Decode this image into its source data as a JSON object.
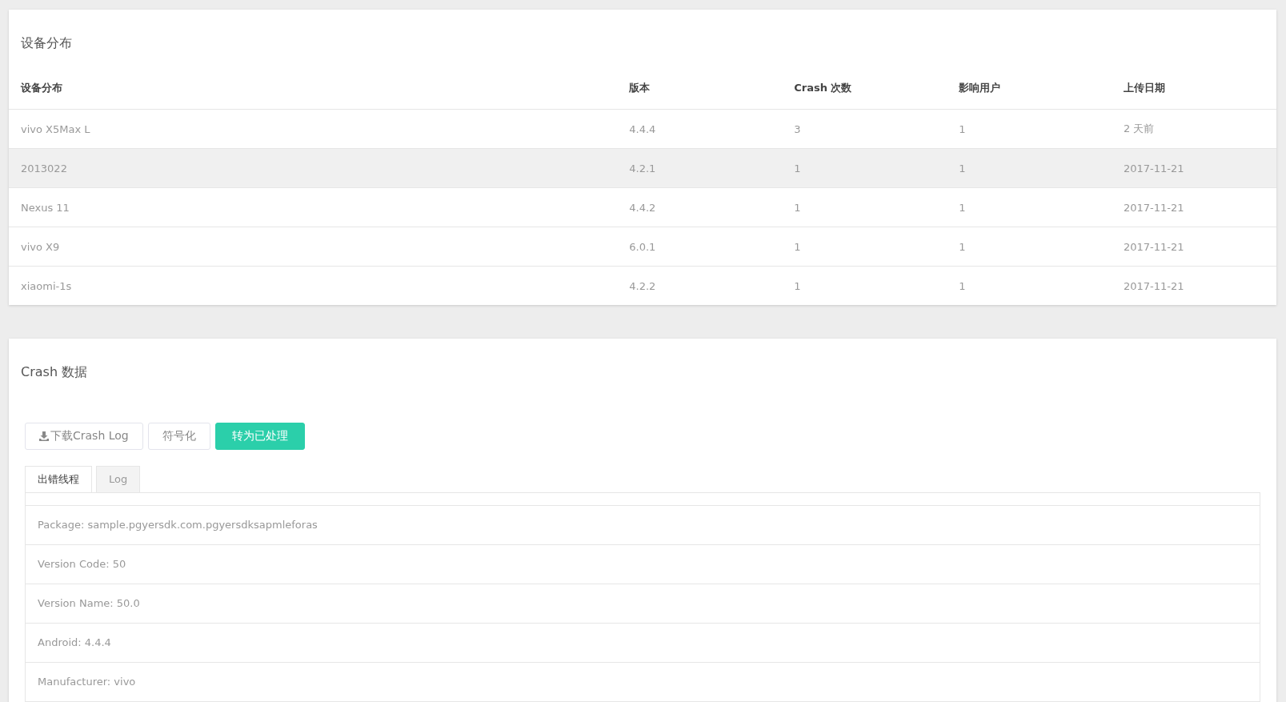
{
  "device_panel": {
    "title": "设备分布",
    "columns": [
      "设备分布",
      "版本",
      "Crash 次数",
      "影响用户",
      "上传日期"
    ],
    "rows": [
      {
        "cells": [
          "vivo X5Max L",
          "4.4.4",
          "3",
          "1",
          "2 天前"
        ],
        "selected": false
      },
      {
        "cells": [
          "2013022",
          "4.2.1",
          "1",
          "1",
          "2017-11-21"
        ],
        "selected": true
      },
      {
        "cells": [
          "Nexus 11",
          "4.4.2",
          "1",
          "1",
          "2017-11-21"
        ],
        "selected": false
      },
      {
        "cells": [
          "vivo X9",
          "6.0.1",
          "1",
          "1",
          "2017-11-21"
        ],
        "selected": false
      },
      {
        "cells": [
          "xiaomi-1s",
          "4.2.2",
          "1",
          "1",
          "2017-11-21"
        ],
        "selected": false
      }
    ]
  },
  "crash_panel": {
    "title": "Crash 数据",
    "buttons": [
      {
        "label": "下载Crash Log",
        "kind": "download"
      },
      {
        "label": "符号化",
        "kind": "plain"
      },
      {
        "label": "转为已处理",
        "kind": "primary"
      }
    ],
    "tabs": [
      {
        "label": "出错线程",
        "selected": true
      },
      {
        "label": "Log",
        "selected": false
      }
    ],
    "details": [
      "Package: sample.pgyersdk.com.pgyersdksapmleforas",
      "Version Code: 50",
      "Version Name: 50.0",
      "Android: 4.4.4",
      "Manufacturer: vivo"
    ]
  }
}
